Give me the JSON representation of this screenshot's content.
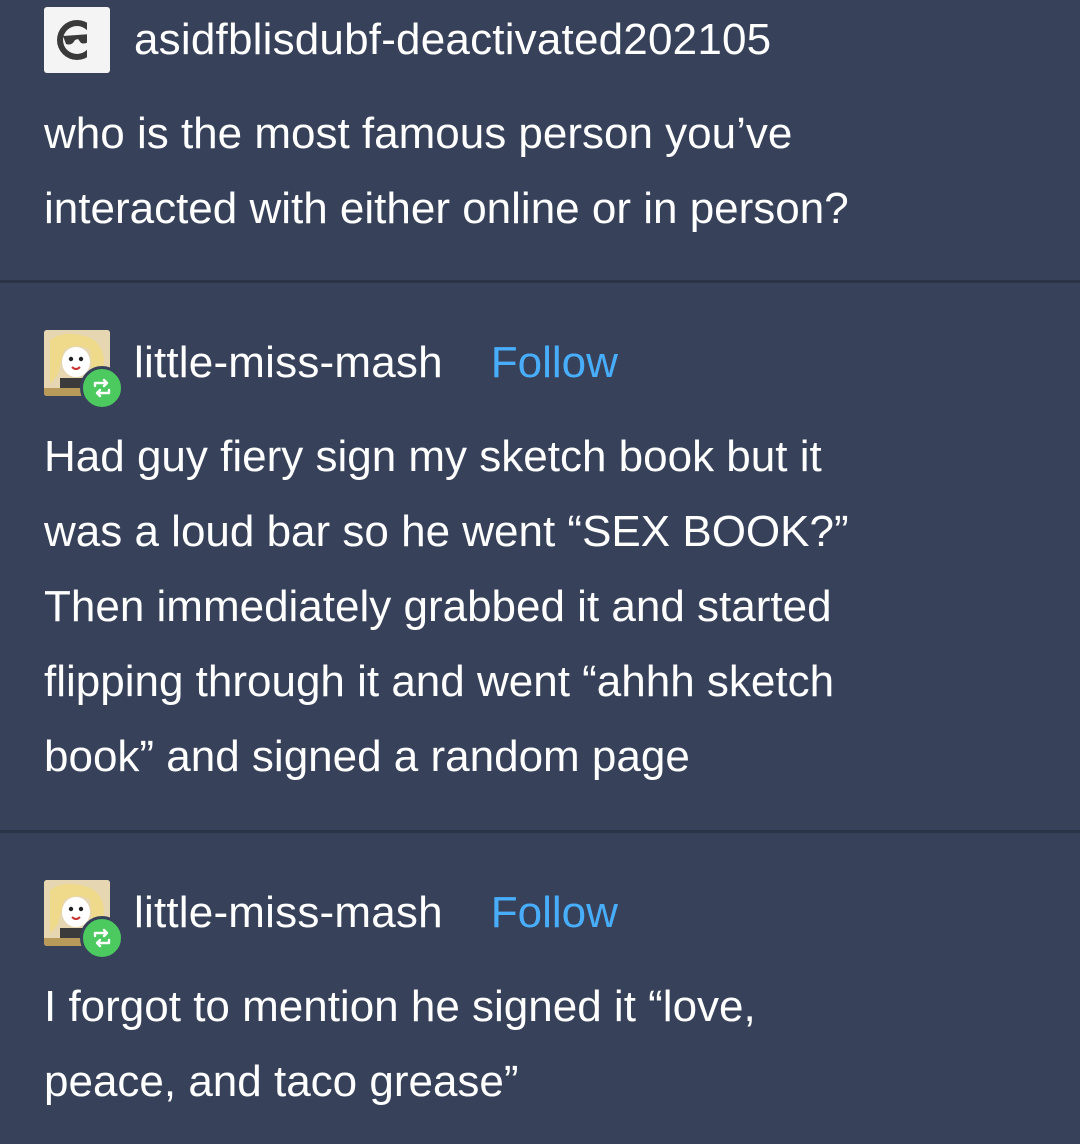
{
  "posts": [
    {
      "username": "asidfblisdubf-deactivated202105",
      "avatar_icon": "deactivated-sunglasses-icon",
      "body": "who is the most famous person you’ve\ninteracted with either online or in person?"
    },
    {
      "username": "little-miss-mash",
      "follow_label": "Follow",
      "avatar_icon": "anime-avatar",
      "badge_icon": "reblog-icon",
      "body": "Had guy fiery sign my sketch book but it\nwas a loud bar so he went “SEX BOOK?”\nThen immediately grabbed it and started\nflipping through it and went “ahhh sketch\nbook” and signed a random page"
    },
    {
      "username": "little-miss-mash",
      "follow_label": "Follow",
      "avatar_icon": "anime-avatar",
      "badge_icon": "reblog-icon",
      "body": "I forgot to mention he signed it “love,\npeace, and taco grease”"
    }
  ],
  "colors": {
    "background": "#37425a",
    "divider": "#2b3447",
    "text": "#ffffff",
    "follow": "#48aefb",
    "reblog_badge": "#4cc95f"
  }
}
